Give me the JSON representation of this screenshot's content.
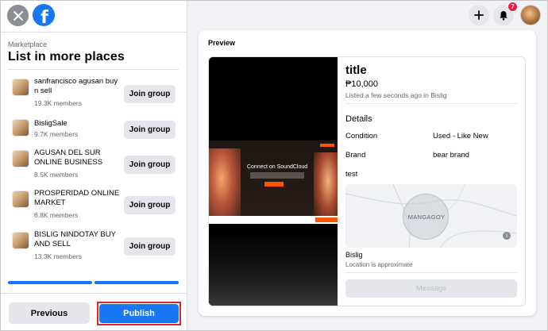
{
  "sidebar": {
    "breadcrumb": "Marketplace",
    "title": "List in more places",
    "groups": [
      {
        "name": "sanfrancisco agusan buy n sell",
        "members": "19.3K members",
        "action": "Join group"
      },
      {
        "name": "BisligSale",
        "members": "9.7K members",
        "action": "Join group"
      },
      {
        "name": "AGUSAN DEL SUR ONLINE BUSINESS",
        "members": "8.5K members",
        "action": "Join group"
      },
      {
        "name": "PROSPERIDAD ONLINE MARKET",
        "members": "6.8K members",
        "action": "Join group"
      },
      {
        "name": "BISLIG NINDOTAY BUY AND SELL",
        "members": "13.3K members",
        "action": "Join group"
      }
    ],
    "previous_label": "Previous",
    "publish_label": "Publish"
  },
  "header": {
    "notification_count": "7"
  },
  "preview": {
    "label": "Preview",
    "media_text": "Connect on SoundCloud",
    "title": "title",
    "price": "₱10,000",
    "listed": "Listed a few seconds ago in Bislig",
    "details_heading": "Details",
    "details": [
      {
        "label": "Condition",
        "value": "Used - Like New"
      },
      {
        "label": "Brand",
        "value": "bear brand"
      }
    ],
    "description": "test",
    "map_label": "MANGAGOY",
    "location": "Bislig",
    "location_note": "Location is approximate",
    "message_label": "Message"
  },
  "colors": {
    "accent": "#1877f2",
    "highlight_border": "#e0242c",
    "badge": "#e41e3f"
  }
}
